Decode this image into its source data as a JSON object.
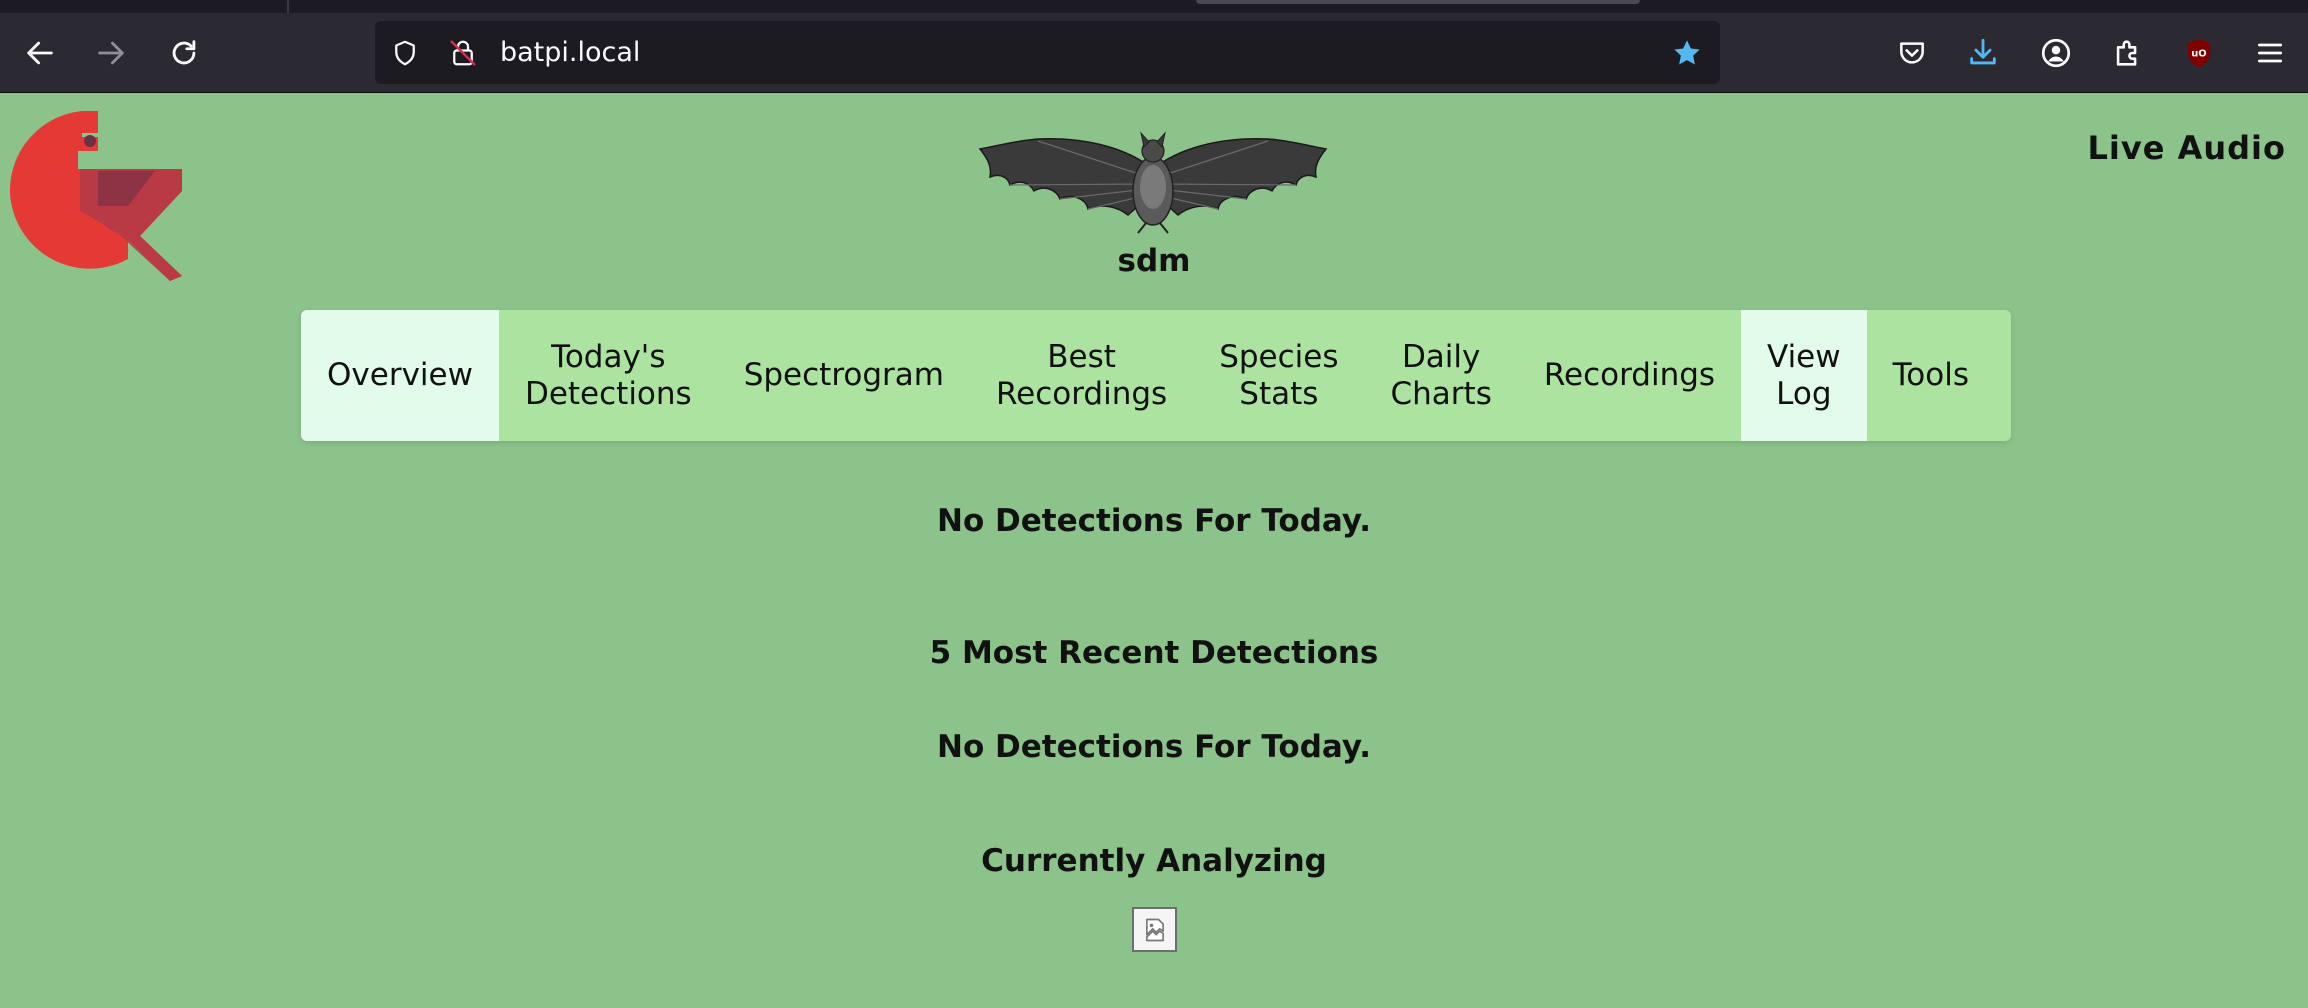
{
  "browser": {
    "url": "batpi.local",
    "icons": {
      "back": "back-arrow-icon",
      "forward": "forward-arrow-icon",
      "reload": "reload-icon",
      "shield": "tracking-protection-shield-icon",
      "lock": "insecure-lock-icon",
      "bookmark": "bookmark-star-icon",
      "pocket": "pocket-icon",
      "downloads": "downloads-icon",
      "account": "account-icon",
      "extensions": "extensions-icon",
      "ublock": "ublock-origin-icon",
      "menu": "hamburger-menu-icon"
    },
    "colors": {
      "star": "#54b8f0",
      "download": "#54b8f0",
      "ublock": "#800000"
    }
  },
  "header": {
    "site_name": "sdm",
    "live_audio": "Live Audio"
  },
  "nav": {
    "items": [
      {
        "label": "Overview",
        "active": true
      },
      {
        "label": "Today's\nDetections",
        "active": false
      },
      {
        "label": "Spectrogram",
        "active": false
      },
      {
        "label": "Best\nRecordings",
        "active": false
      },
      {
        "label": "Species\nStats",
        "active": false
      },
      {
        "label": "Daily\nCharts",
        "active": false
      },
      {
        "label": "Recordings",
        "active": false
      },
      {
        "label": "View\nLog",
        "active": true
      },
      {
        "label": "Tools",
        "active": false
      }
    ]
  },
  "main": {
    "no_detections_1": "No Detections For Today.",
    "recent_heading": "5 Most Recent Detections",
    "no_detections_2": "No Detections For Today.",
    "currently_analyzing": "Currently Analyzing"
  },
  "colors": {
    "page_bg": "#8bc38b",
    "nav_bg": "#ace3a1",
    "nav_active_bg": "#e3fbeb"
  }
}
